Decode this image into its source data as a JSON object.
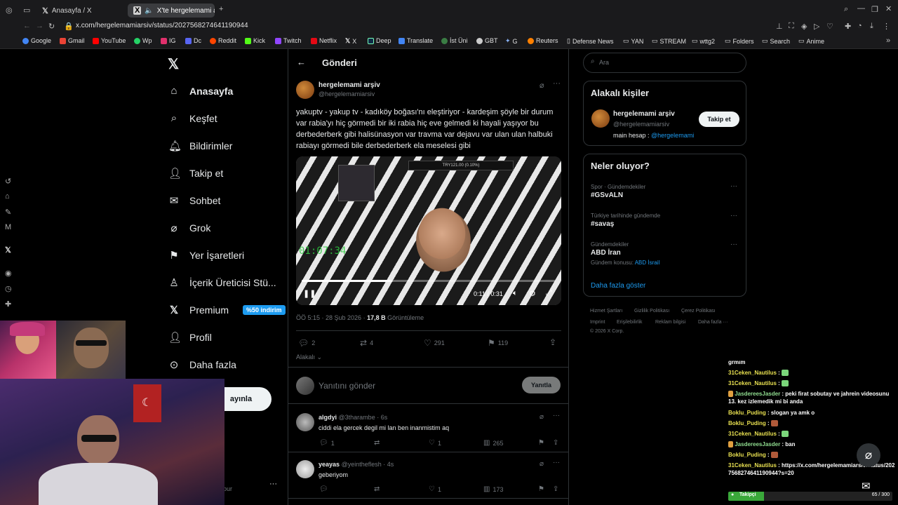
{
  "browser": {
    "tabs": [
      {
        "label": "Anasayfa / X"
      },
      {
        "label": "X'te hergelemami arşiv"
      }
    ],
    "url": "x.com/hergelemamiarsiv/status/2027568274641190944",
    "bookmarks": [
      {
        "label": "Google",
        "color": "#4285f4"
      },
      {
        "label": "Gmail",
        "color": "#ea4335"
      },
      {
        "label": "YouTube",
        "color": "#ff0000"
      },
      {
        "label": "Wp",
        "color": "#25d366"
      },
      {
        "label": "IG",
        "color": "#e1306c"
      },
      {
        "label": "Dc",
        "color": "#5865f2"
      },
      {
        "label": "Reddit",
        "color": "#ff4500"
      },
      {
        "label": "Kick",
        "color": "#53fc18"
      },
      {
        "label": "Twitch",
        "color": "#9146ff"
      },
      {
        "label": "Netflix",
        "color": "#e50914"
      },
      {
        "label": "X",
        "color": "#ffffff"
      },
      {
        "label": "Deep",
        "color": "#0f2b46"
      },
      {
        "label": "Translate",
        "color": "#4285f4"
      },
      {
        "label": "İst Üni",
        "color": "#3a7d44"
      },
      {
        "label": "GBT",
        "color": "#cccccc"
      },
      {
        "label": "G",
        "color": "#8ab4f8"
      },
      {
        "label": "Reuters",
        "color": "#ff8000"
      },
      {
        "label": "Defense News",
        "color": "#888888"
      },
      {
        "label": "YAN",
        "color": "#888888"
      },
      {
        "label": "STREAM",
        "color": "#888888"
      },
      {
        "label": "wttg2",
        "color": "#888888"
      },
      {
        "label": "Folders",
        "color": "#888888"
      },
      {
        "label": "Search",
        "color": "#888888"
      },
      {
        "label": "Anime",
        "color": "#888888"
      }
    ]
  },
  "nav": {
    "items": [
      {
        "label": "Anasayfa",
        "icon": "home-icon"
      },
      {
        "label": "Keşfet",
        "icon": "search-icon"
      },
      {
        "label": "Bildirimler",
        "icon": "bell-icon"
      },
      {
        "label": "Takip et",
        "icon": "follow-icon"
      },
      {
        "label": "Sohbet",
        "icon": "mail-icon"
      },
      {
        "label": "Grok",
        "icon": "grok-icon"
      },
      {
        "label": "Yer İşaretleri",
        "icon": "bookmark-icon"
      },
      {
        "label": "İçerik Üreticisi Stü...",
        "icon": "creator-icon"
      },
      {
        "label": "Premium",
        "icon": "x-icon"
      },
      {
        "label": "Profil",
        "icon": "profile-icon"
      },
      {
        "label": "Daha fazla",
        "icon": "more-icon"
      }
    ],
    "premium_badge": "%50 indirim",
    "post_button": "ayınla",
    "bottom_text": "our"
  },
  "post": {
    "header": "Gönderi",
    "author_name": "hergelemami arşiv",
    "author_handle": "@hergelemamiarsiv",
    "text": "yakuptv - yakup tv - kadıköy boğası'nı eleştiriyor - kardeşim şöyle bir durum var rabia'yı hiç görmedi bir iki rabia hiç eve gelmedi ki hayali yaşıyor bu derbederberk gibi halisünasyon var travma var dejavu var ulan ulan halbuki rabiayı görmedi bile derbederberk ela meselesi gibi",
    "video": {
      "time": "0:11 / 0:31",
      "overlay_timer": "01:07:34",
      "progress": 0.355,
      "banner_text": "TRY121.00 (0.10%)"
    },
    "meta_time": "ÖÖ 5:15 · 28 Şub 2026 · ",
    "views": "17,8 B",
    "views_label": "Görüntüleme",
    "replies": "2",
    "reposts": "4",
    "likes": "291",
    "bookmarks": "119",
    "sort_label": "Alakalı",
    "reply_placeholder": "Yanıtını gönder",
    "reply_button": "Yanıtla"
  },
  "replies": [
    {
      "name": "algdyi",
      "handle": "@3tharambe · 6s",
      "text": "ciddi ela gercek degil mi lan ben inanmistim aq",
      "replies": "1",
      "likes": "1",
      "views": "265"
    },
    {
      "name": "yeayas",
      "handle": "@yeintheflesh · 4s",
      "text": "geberiyom",
      "replies": "",
      "likes": "1",
      "views": "173"
    }
  ],
  "right": {
    "search_placeholder": "Ara",
    "related_title": "Alakalı kişiler",
    "related_name": "hergelemami arşiv",
    "related_handle": "@hergelemamiarsiv",
    "related_bio_prefix": "main hesap : ",
    "related_bio_link": "@hergelemami",
    "follow_button": "Takip et",
    "trends_title": "Neler oluyor?",
    "trends": [
      {
        "category": "Spor · Gündemdekiler",
        "title": "#GSvALN",
        "sub": "",
        "sub_link": ""
      },
      {
        "category": "Türkiye tarihinde gündemde",
        "title": "#savaş",
        "sub": "",
        "sub_link": ""
      },
      {
        "category": "Gündemdekiler",
        "title": "ABD İran",
        "sub": "Gündem konusu: ",
        "sub_link": "ABD İsrail"
      }
    ],
    "show_more": "Daha fazla göster",
    "footer_links": [
      "Hizmet Şartları",
      "Gizlilik Politikası",
      "Çerez Politikası",
      "Imprint",
      "Erişilebilirlik",
      "Reklam bilgisi",
      "Daha fazla ···"
    ],
    "copyright": "© 2026 X Corp."
  },
  "chat": {
    "lines": [
      {
        "name": "",
        "text": "grmım"
      },
      {
        "name": "31Ceken_Nautilus",
        "text": " : "
      },
      {
        "name": "31Ceken_Nautilus",
        "text": " : "
      },
      {
        "name": "JasdereesJasder",
        "text": " : peki firat sobutay ve jahrein videosunu 13. kez izlemedik mi bi anda"
      },
      {
        "name": "Boklu_Puding",
        "text": " : slogan ya amk o"
      },
      {
        "name": "Boklu_Puding",
        "text": " : "
      },
      {
        "name": "31Ceken_Nautilus",
        "text": " : "
      },
      {
        "name": "JasdereesJasder",
        "text": " : ban"
      },
      {
        "name": "Boklu_Puding",
        "text": " : "
      },
      {
        "name": "31Ceken_Nautilus",
        "text": " : https://x.com/hergelemamiarsiv/status/2027568274641190944?s=20"
      }
    ],
    "goal_label": "Takipçi",
    "goal_count": "65 / 300",
    "goal_progress": 0.2167
  },
  "colors": {
    "accent": "#1d9bf0",
    "background": "#000000",
    "muted": "#71767b"
  }
}
